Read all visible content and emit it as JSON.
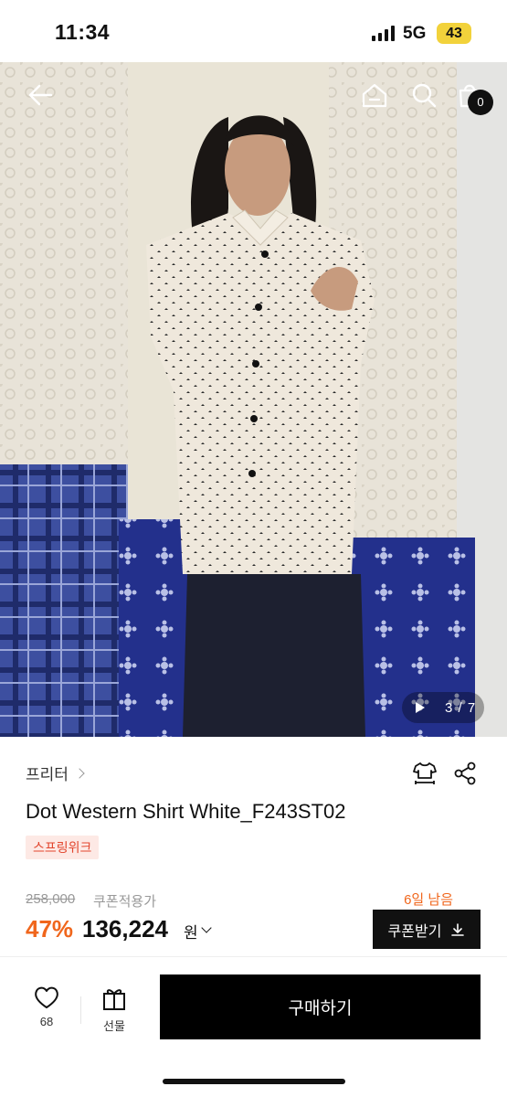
{
  "status": {
    "time": "11:34",
    "network": "5G",
    "battery": "43"
  },
  "hero": {
    "cart_count": "0",
    "slide_counter": "3 / 7",
    "icons": {
      "back": "arrow-left-icon",
      "home": "home-icon",
      "search": "search-icon",
      "cart": "shopping-bag-icon",
      "play": "play-icon"
    }
  },
  "product": {
    "brand": "프리터",
    "name": "Dot Western Shirt White_F243ST02",
    "promo_badge": "스프링위크",
    "original_price": "258,000",
    "coupon_label": "쿠폰적용가",
    "days_left": "6일 남음",
    "discount": "47%",
    "price": "136,224",
    "currency": "원",
    "coupon_button": "쿠폰받기",
    "icons": {
      "size": "size-guide-shirt-icon",
      "share": "share-icon",
      "download": "download-icon"
    }
  },
  "bottom_bar": {
    "like_count": "68",
    "gift_label": "선물",
    "buy_label": "구매하기",
    "icons": {
      "like": "heart-icon",
      "gift": "gift-icon"
    }
  },
  "colors": {
    "accent": "#f0661c",
    "promo_bg": "#fde9e5",
    "promo_text": "#e2452d",
    "button_black": "#000000",
    "battery": "#f2d23b"
  }
}
